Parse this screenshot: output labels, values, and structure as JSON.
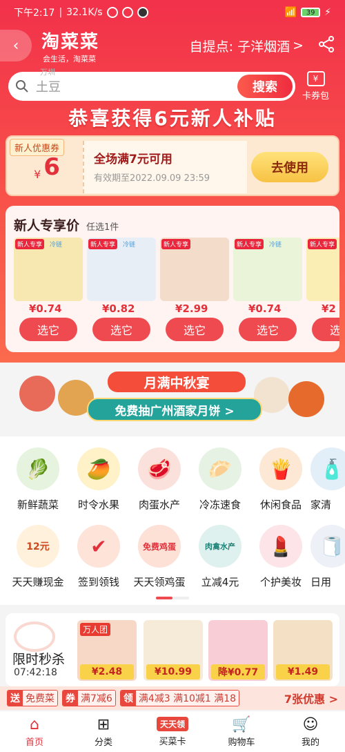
{
  "status_bar": {
    "time": "下午2:17",
    "speed": "32.1K/s",
    "battery": "39"
  },
  "header": {
    "brand": "淘菜菜",
    "slogan": "会生活，淘菜菜",
    "pickup": "自提点: 子洋烟酒",
    "pickup_arrow": ">"
  },
  "search": {
    "hint_top": "万圳",
    "placeholder": "土豆",
    "button": "搜索",
    "coupon_pack": "卡券包"
  },
  "banner": {
    "title": "恭喜获得6元新人补贴"
  },
  "new_coupon": {
    "tag": "新人优惠券",
    "currency": "¥",
    "amount": "6",
    "condition": "全场满7元可用",
    "validity": "有效期至2022.09.09 23:59",
    "button": "去使用"
  },
  "exclusive": {
    "title": "新人专享价",
    "subtitle": "任选1件",
    "products": [
      {
        "badge": "新人专享",
        "cold": "冷链",
        "price": "¥0.74",
        "pick": "选它",
        "color": "#f6e8b0"
      },
      {
        "badge": "新人专享",
        "cold": "冷链",
        "price": "¥0.82",
        "pick": "选它",
        "color": "#e8eef6"
      },
      {
        "badge": "新人专享",
        "cold": "",
        "price": "¥2.99",
        "pick": "选它",
        "color": "#f3dcc9"
      },
      {
        "badge": "新人专享",
        "cold": "冷链",
        "price": "¥0.74",
        "pick": "选它",
        "color": "#eaf4d8"
      },
      {
        "badge": "新人专享",
        "cold": "",
        "price": "¥2",
        "pick": "选它",
        "color": "#fbeeb4"
      }
    ]
  },
  "autumn": {
    "line1": "月满中秋宴",
    "line2": "免费抽广州酒家月饼 >"
  },
  "categories": [
    {
      "label": "新鲜蔬菜",
      "icon": "vegetable-icon",
      "glyph": "🥬"
    },
    {
      "label": "时令水果",
      "icon": "fruit-icon",
      "glyph": "🥭"
    },
    {
      "label": "肉蛋水产",
      "icon": "meat-icon",
      "glyph": "🥩"
    },
    {
      "label": "冷冻速食",
      "icon": "frozen-food-icon",
      "glyph": "🥟"
    },
    {
      "label": "休闲食品",
      "icon": "snack-icon",
      "glyph": "🍟"
    },
    {
      "label": "家清",
      "icon": "cleaning-icon",
      "glyph": "🧴"
    },
    {
      "label": "天天赚现金",
      "icon": "cash-icon",
      "glyph": "12元"
    },
    {
      "label": "签到领钱",
      "icon": "checkin-icon",
      "glyph": "✔"
    },
    {
      "label": "天天领鸡蛋",
      "icon": "egg-icon",
      "glyph": "免费鸡蛋"
    },
    {
      "label": "立减4元",
      "icon": "discount-icon",
      "glyph": "肉禽水产"
    },
    {
      "label": "个护美妆",
      "icon": "beauty-icon",
      "glyph": "💄"
    },
    {
      "label": "日用",
      "icon": "daily-icon",
      "glyph": "🧻"
    }
  ],
  "flash_sale": {
    "title": "限时秒杀",
    "timer": "07:42:18",
    "items": [
      {
        "tag": "万人团",
        "price": "¥2.48",
        "color": "#f7d8c6"
      },
      {
        "tag": "",
        "price": "¥10.99",
        "color": "#f6ead8"
      },
      {
        "tag": "",
        "price": "降¥0.77",
        "color": "#f8cdd6"
      },
      {
        "tag": "",
        "price": "¥1.49",
        "color": "#f4e0c4"
      }
    ]
  },
  "promo": {
    "tags": [
      {
        "k": "送",
        "v": "免费菜"
      },
      {
        "k": "券",
        "v": "满7减6"
      },
      {
        "k": "领",
        "v": "满4减3  满10减1  满18"
      }
    ],
    "more": "7张优惠 >"
  },
  "tabbar": [
    {
      "label": "首页",
      "icon": "home-icon",
      "glyph": "⌂"
    },
    {
      "label": "分类",
      "icon": "category-icon",
      "glyph": "⊞"
    },
    {
      "label": "买菜卡",
      "icon": "card-icon",
      "glyph": "天天领"
    },
    {
      "label": "购物车",
      "icon": "cart-icon",
      "glyph": "🛒"
    },
    {
      "label": "我的",
      "icon": "profile-icon",
      "glyph": "☺"
    }
  ]
}
